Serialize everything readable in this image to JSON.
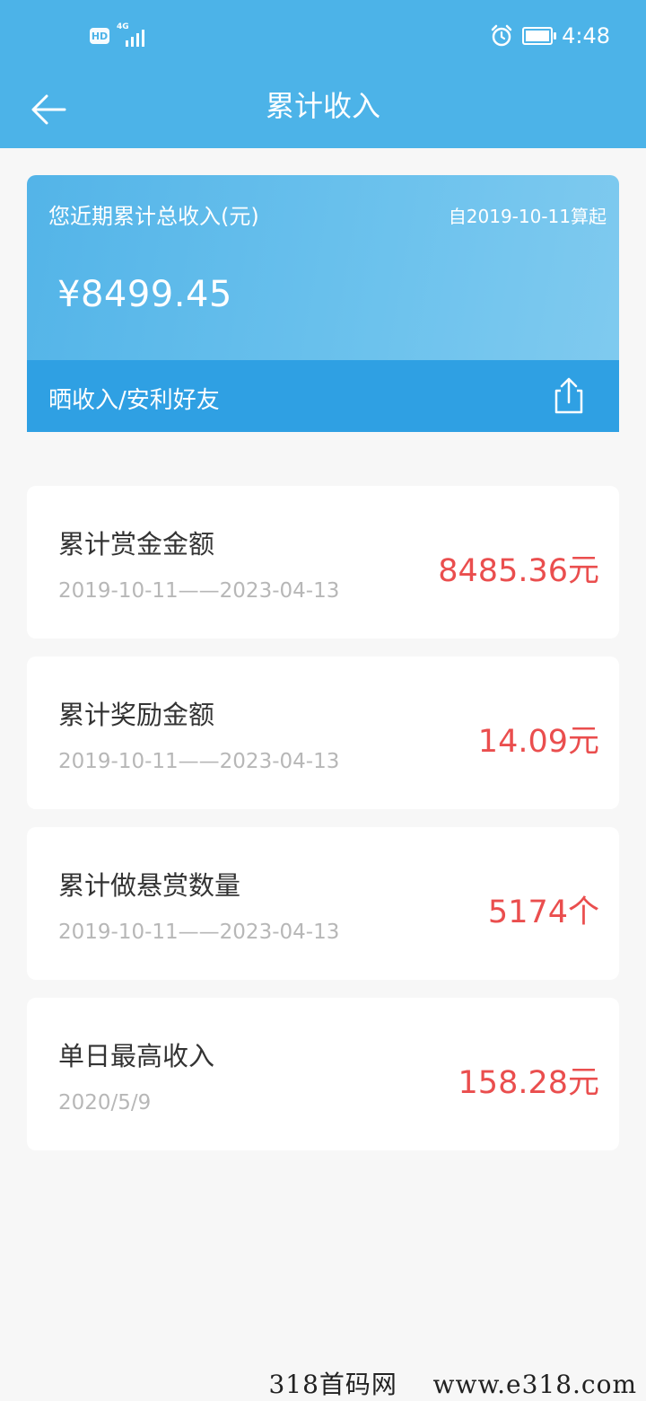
{
  "status_bar": {
    "hd": "HD",
    "network": "4G",
    "time": "4:48",
    "icons": [
      "alarm-icon",
      "battery-charging-icon",
      "signal-icon"
    ]
  },
  "header": {
    "title": "累计收入",
    "back_icon": "arrow-left-icon"
  },
  "summary": {
    "label": "您近期累计总收入(元)",
    "since": "自2019-10-11算起",
    "amount": "¥8499.45",
    "share_label": "晒收入/安利好友",
    "share_icon": "share-icon"
  },
  "stats": [
    {
      "title": "累计赏金金额",
      "range": "2019-10-11——2023-04-13",
      "value": "8485.36元"
    },
    {
      "title": "累计奖励金额",
      "range": "2019-10-11——2023-04-13",
      "value": "14.09元"
    },
    {
      "title": "累计做悬赏数量",
      "range": "2019-10-11——2023-04-13",
      "value": "5174个"
    },
    {
      "title": "单日最高收入",
      "range": "2020/5/9",
      "value": "158.28元"
    }
  ],
  "watermark": "318首码网    www.e318.com",
  "colors": {
    "header_bg": "#4cb3e8",
    "share_bar_bg": "#2fa0e3",
    "value_red": "#ea4e4e",
    "page_bg": "#f7f7f7"
  }
}
